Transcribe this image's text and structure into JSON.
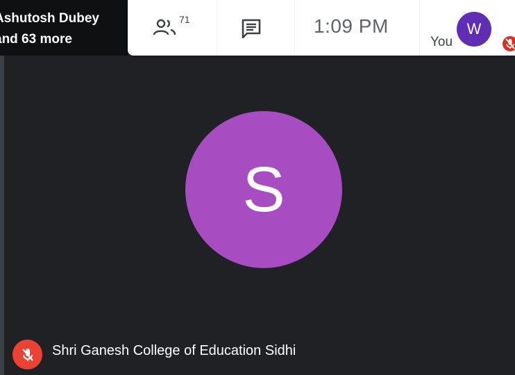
{
  "presenter": {
    "line1": "Ashutosh Dubey",
    "line2": "and 63 more"
  },
  "toolbar": {
    "people_count": "71",
    "time": "1:09  PM"
  },
  "self": {
    "initial": "W",
    "label": "You"
  },
  "main_tile": {
    "initial": "S",
    "participant_name": "Shri Ganesh College of Education Sidhi"
  },
  "colors": {
    "background": "#202124",
    "main_avatar": "#a84cc2",
    "self_avatar": "#5f2eb5",
    "mute_red": "#ea4335"
  },
  "icons": {
    "people": "people-icon",
    "chat": "chat-icon",
    "mic_off": "mic-off-icon"
  }
}
